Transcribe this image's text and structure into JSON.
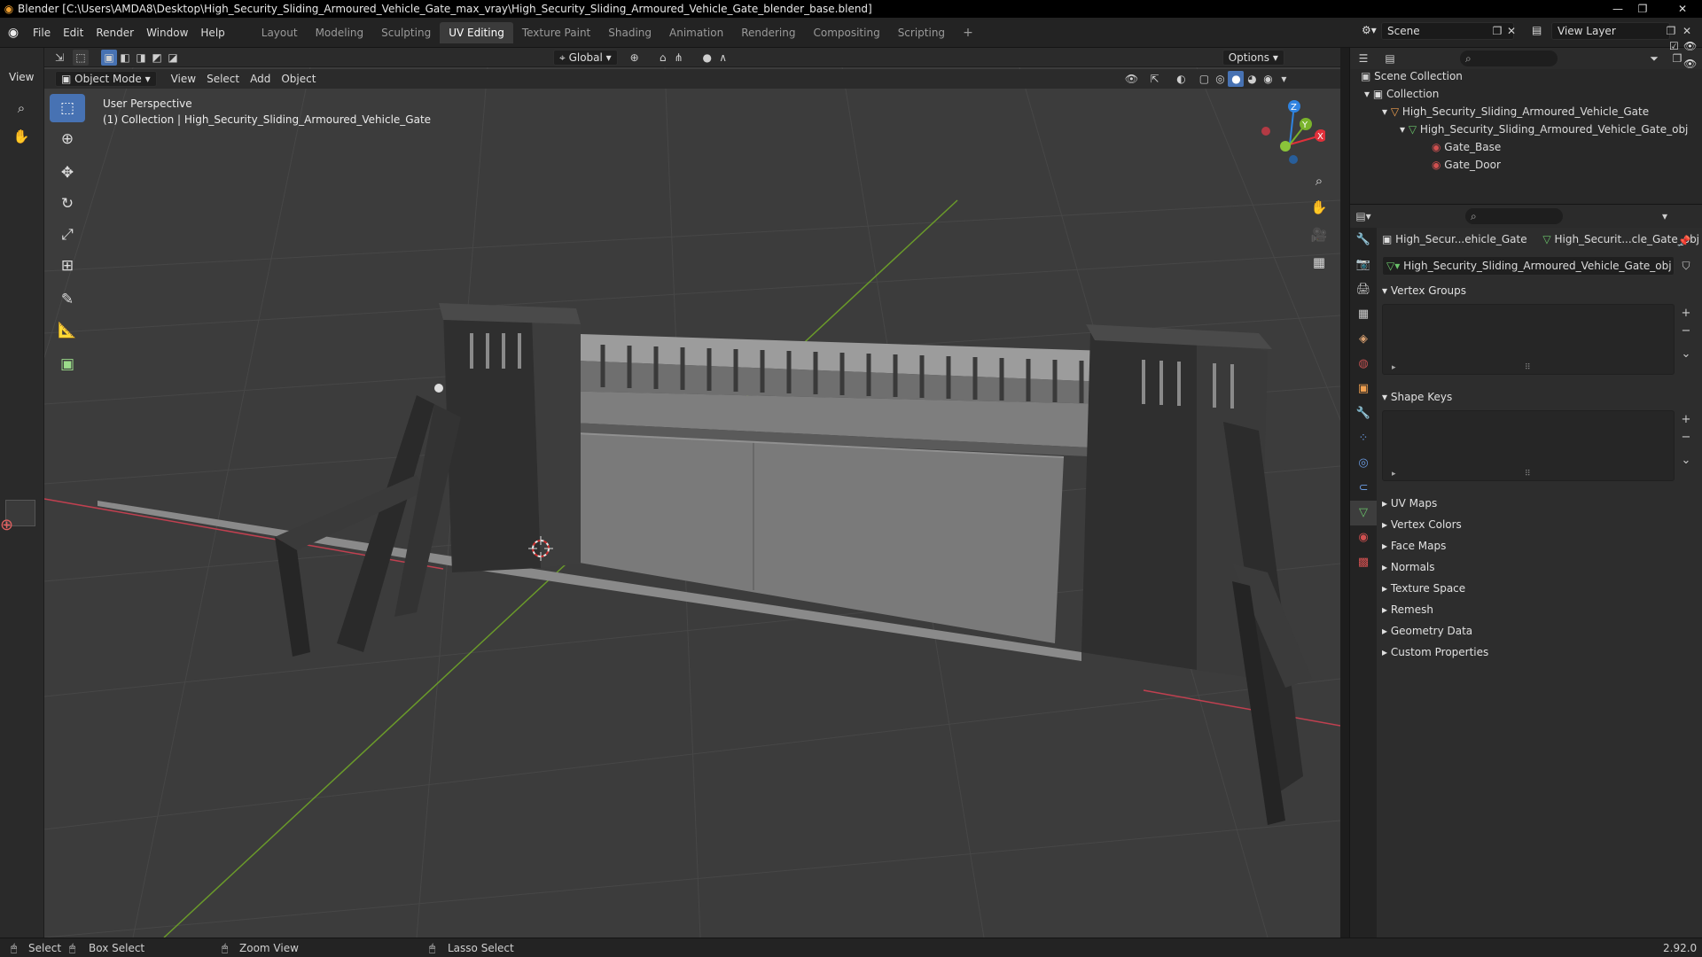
{
  "window": {
    "title": "Blender [C:\\Users\\AMDA8\\Desktop\\High_Security_Sliding_Armoured_Vehicle_Gate_max_vray\\High_Security_Sliding_Armoured_Vehicle_Gate_blender_base.blend]"
  },
  "menu": [
    "File",
    "Edit",
    "Render",
    "Window",
    "Help"
  ],
  "workspaces": [
    "Layout",
    "Modeling",
    "Sculpting",
    "UV Editing",
    "Texture Paint",
    "Shading",
    "Animation",
    "Rendering",
    "Compositing",
    "Scripting"
  ],
  "active_workspace": "UV Editing",
  "scene": "Scene",
  "view_layer": "View Layer",
  "header": {
    "transform_orientation": "Global",
    "options": "Options",
    "view_label": "View"
  },
  "viewport_header": {
    "mode": "Object Mode",
    "menus": [
      "View",
      "Select",
      "Add",
      "Object"
    ]
  },
  "viewport": {
    "perspective": "User Perspective",
    "collection_info": "(1) Collection | High_Security_Sliding_Armoured_Vehicle_Gate"
  },
  "outliner": {
    "scene_collection": "Scene Collection",
    "collection": "Collection",
    "object": "High_Security_Sliding_Armoured_Vehicle_Gate",
    "mesh_data": "High_Security_Sliding_Armoured_Vehicle_Gate_obj",
    "materials": [
      "Gate_Base",
      "Gate_Door"
    ]
  },
  "properties": {
    "breadcrumb_object": "High_Secur...ehicle_Gate",
    "breadcrumb_data": "High_Securit...cle_Gate_obj",
    "data_name": "High_Security_Sliding_Armoured_Vehicle_Gate_obj",
    "expanded_panels": [
      "Vertex Groups",
      "Shape Keys"
    ],
    "collapsed_panels": [
      "UV Maps",
      "Vertex Colors",
      "Face Maps",
      "Normals",
      "Texture Space",
      "Remesh",
      "Geometry Data",
      "Custom Properties"
    ]
  },
  "gizmo": {
    "x": "X",
    "y": "Y",
    "z": "Z"
  },
  "status": {
    "select": "Select",
    "box_select": "Box Select",
    "zoom_view": "Zoom View",
    "lasso_select": "Lasso Select",
    "version": "2.92.0"
  },
  "colors": {
    "accent": "#4772b3",
    "x_axis": "#e0303a",
    "y_axis": "#7ab32b",
    "z_axis": "#2f83e0"
  }
}
